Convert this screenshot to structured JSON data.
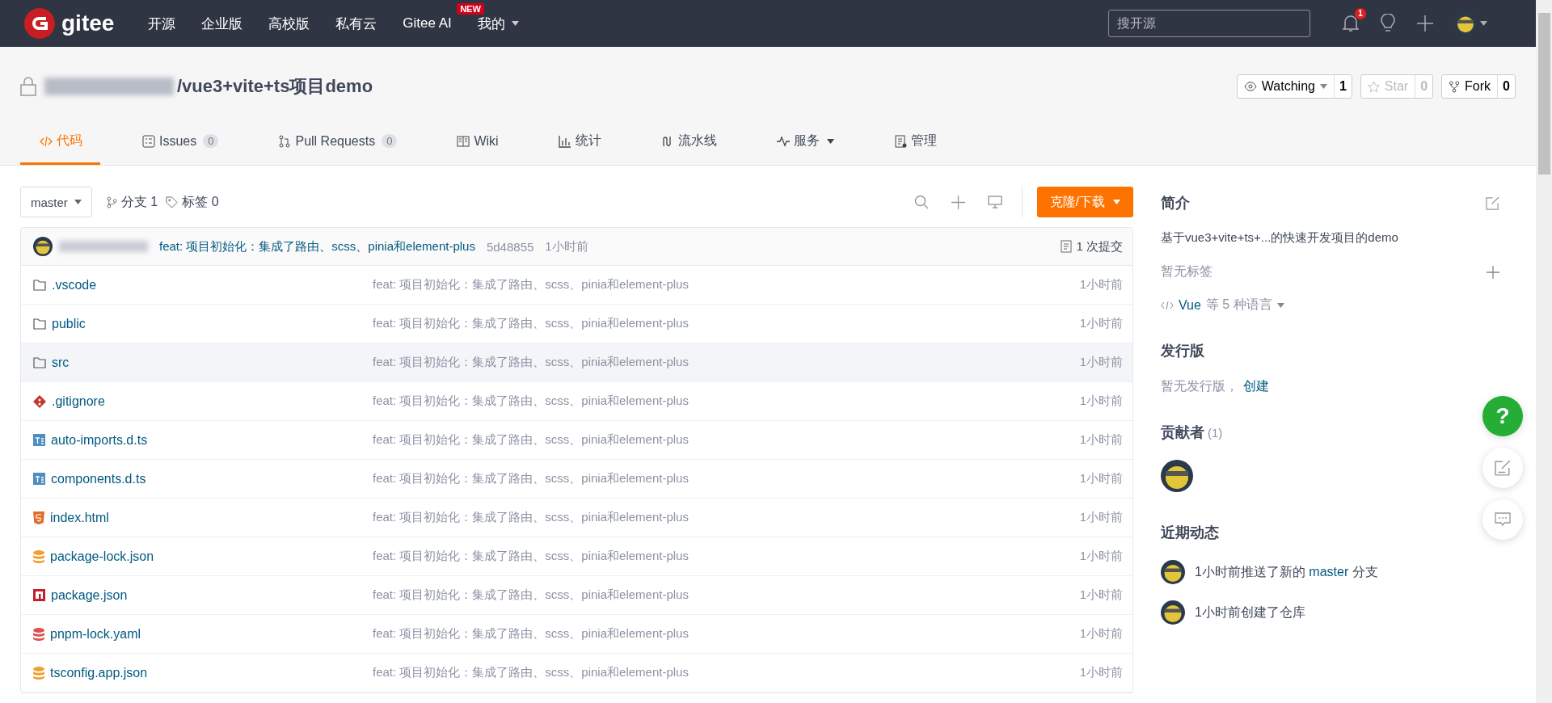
{
  "navbar": {
    "logo_text": "gitee",
    "items": [
      {
        "label": "开源"
      },
      {
        "label": "企业版"
      },
      {
        "label": "高校版"
      },
      {
        "label": "私有云"
      },
      {
        "label": "Gitee AI",
        "badge": "NEW"
      },
      {
        "label": "我的",
        "dropdown": true
      }
    ],
    "search": {
      "placeholder": "搜开源"
    },
    "notification_count": "1"
  },
  "repo": {
    "title": "/vue3+vite+ts项目demo",
    "actions": [
      {
        "label": "Watching",
        "count": "1",
        "kind": "watch",
        "disabled": false
      },
      {
        "label": "Star",
        "count": "0",
        "kind": "star",
        "disabled": true
      },
      {
        "label": "Fork",
        "count": "0",
        "kind": "fork",
        "disabled": false
      }
    ]
  },
  "tabs": [
    {
      "label": "代码",
      "kind": "code",
      "selected": true
    },
    {
      "label": "Issues",
      "count": "0",
      "kind": "issues",
      "selected": false
    },
    {
      "label": "Pull Requests",
      "count": "0",
      "kind": "pr",
      "selected": false
    },
    {
      "label": "Wiki",
      "kind": "wiki",
      "selected": false
    },
    {
      "label": "统计",
      "kind": "stats",
      "selected": false
    },
    {
      "label": "流水线",
      "kind": "pipeline",
      "selected": false
    },
    {
      "label": "服务",
      "kind": "service",
      "dropdown": true,
      "selected": false
    },
    {
      "label": "管理",
      "kind": "manage",
      "selected": false
    }
  ],
  "toolbar": {
    "branch": "master",
    "branches": "分支 1",
    "tags": "标签 0",
    "clone_button": "克隆/下载"
  },
  "last_commit": {
    "message": "feat: 项目初始化：集成了路由、scss、pinia和element-plus",
    "hash": "5d48855",
    "time": "1小时前",
    "commits": "1 次提交"
  },
  "files": [
    {
      "name": ".vscode",
      "kind": "folder",
      "message": "feat: 项目初始化：集成了路由、scss、pinia和element-plus",
      "time": "1小时前",
      "hovered": false
    },
    {
      "name": "public",
      "kind": "folder",
      "message": "feat: 项目初始化：集成了路由、scss、pinia和element-plus",
      "time": "1小时前",
      "hovered": false
    },
    {
      "name": "src",
      "kind": "folder",
      "message": "feat: 项目初始化：集成了路由、scss、pinia和element-plus",
      "time": "1小时前",
      "hovered": true
    },
    {
      "name": ".gitignore",
      "kind": "git",
      "message": "feat: 项目初始化：集成了路由、scss、pinia和element-plus",
      "time": "1小时前",
      "hovered": false
    },
    {
      "name": "auto-imports.d.ts",
      "kind": "ts",
      "message": "feat: 项目初始化：集成了路由、scss、pinia和element-plus",
      "time": "1小时前",
      "hovered": false
    },
    {
      "name": "components.d.ts",
      "kind": "ts",
      "message": "feat: 项目初始化：集成了路由、scss、pinia和element-plus",
      "time": "1小时前",
      "hovered": false
    },
    {
      "name": "index.html",
      "kind": "html",
      "message": "feat: 项目初始化：集成了路由、scss、pinia和element-plus",
      "time": "1小时前",
      "hovered": false
    },
    {
      "name": "package-lock.json",
      "kind": "lock",
      "message": "feat: 项目初始化：集成了路由、scss、pinia和element-plus",
      "time": "1小时前",
      "hovered": false
    },
    {
      "name": "package.json",
      "kind": "npm",
      "message": "feat: 项目初始化：集成了路由、scss、pinia和element-plus",
      "time": "1小时前",
      "hovered": false
    },
    {
      "name": "pnpm-lock.yaml",
      "kind": "yaml",
      "message": "feat: 项目初始化：集成了路由、scss、pinia和element-plus",
      "time": "1小时前",
      "hovered": false
    },
    {
      "name": "tsconfig.app.json",
      "kind": "lock",
      "message": "feat: 项目初始化：集成了路由、scss、pinia和element-plus",
      "time": "1小时前",
      "hovered": false
    }
  ],
  "sidebar": {
    "intro_title": "简介",
    "description": "基于vue3+vite+ts+...的快速开发项目的demo",
    "no_tags": "暂无标签",
    "language_link": "Vue",
    "language_rest": "等 5 种语言",
    "releases_title": "发行版",
    "no_releases": "暂无发行版，",
    "create_link": "创建",
    "contributors_title": "贡献者",
    "contributors_count": "(1)",
    "activity_title": "近期动态",
    "activity": [
      {
        "before": "1小时前推送了新的",
        "link": "master",
        "after": "分支"
      },
      {
        "before": "1小时前创建了仓库"
      }
    ]
  },
  "floating": {
    "help": "?"
  }
}
